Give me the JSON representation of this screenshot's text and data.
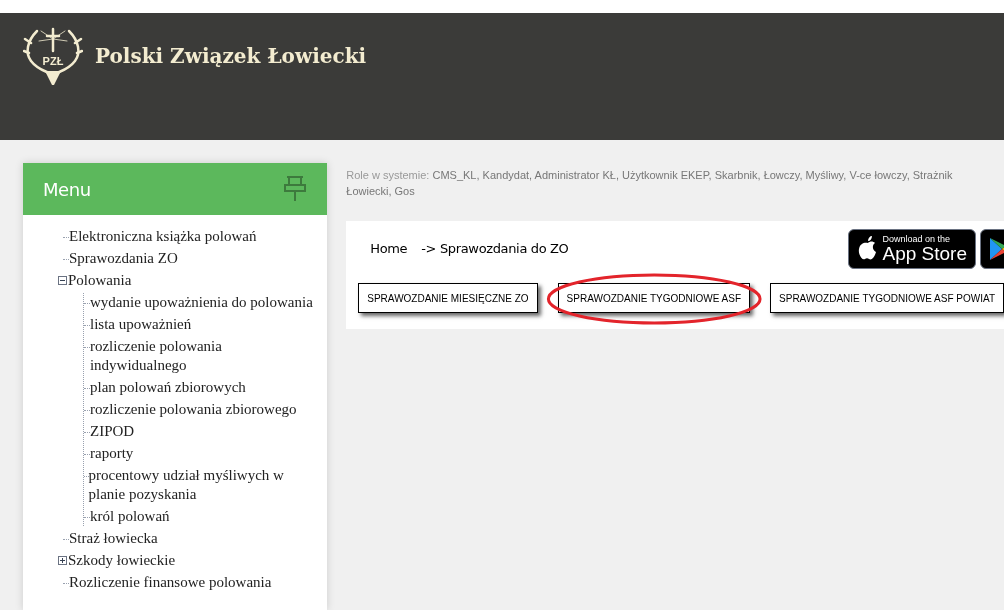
{
  "header": {
    "logo_text": "PZŁ",
    "title": "Polski Związek Łowiecki"
  },
  "menu": {
    "title": "Menu",
    "items": [
      {
        "label": "Elektroniczna książka polowań"
      },
      {
        "label": "Sprawozdania ZO"
      },
      {
        "label": "Polowania",
        "expanded": true,
        "children": [
          {
            "label": "wydanie upoważnienia do polowania"
          },
          {
            "label": "lista upoważnień"
          },
          {
            "label": "rozliczenie polowania indywidualnego"
          },
          {
            "label": "plan polowań zbiorowych"
          },
          {
            "label": "rozliczenie polowania zbiorowego"
          },
          {
            "label": "ZIPOD"
          },
          {
            "label": "raporty"
          },
          {
            "label": "procentowy udział myśliwych w planie pozyskania"
          },
          {
            "label": "król polowań"
          }
        ]
      },
      {
        "label": "Straż łowiecka"
      },
      {
        "label": "Szkody łowieckie",
        "expanded": false
      },
      {
        "label": "Rozliczenie finansowe polowania"
      }
    ]
  },
  "roles": {
    "label": "Role w systemie:",
    "value": "CMS_KL, Kandydat, Administrator KŁ, Użytkownik EKEP, Skarbnik, Łowczy, Myśliwy, V-ce łowczy, Strażnik Łowiecki, Gos"
  },
  "breadcrumb": [
    "Home",
    "-> Sprawozdania do ZO"
  ],
  "store_badges": [
    {
      "kind": "appstore",
      "line1": "Download on the",
      "line2": "App Store"
    },
    {
      "kind": "googleplay"
    }
  ],
  "report_buttons": [
    {
      "label": "SPRAWOZDANIE MIESIĘCZNE ZO",
      "circled": false
    },
    {
      "label": "SPRAWOZDANIE TYGODNIOWE ASF",
      "circled": true
    },
    {
      "label": "SPRAWOZDANIE TYGODNIOWE ASF POWIAT",
      "circled": false
    }
  ]
}
